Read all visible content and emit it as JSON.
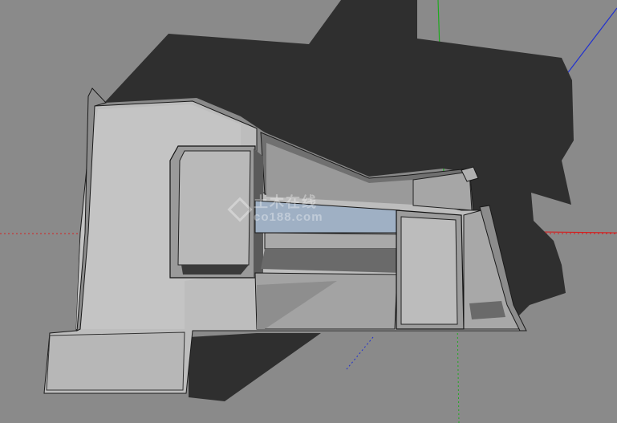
{
  "app": {
    "view": "sketchup-3d-viewport"
  },
  "scene": {
    "description_colors": {
      "background": "#8a8a8a",
      "shadow": "#2f2f2f",
      "floor": "#bdbdbd",
      "wall_dark": "#6f6f6f",
      "edge": "#1a1a1a",
      "axis_red": "#d42020",
      "axis_green": "#1faa1f",
      "axis_blue": "#2030d0",
      "glass": "#9fb0c4"
    }
  },
  "watermark": {
    "cn_text": "土木在线",
    "latin_text": "co188.com"
  }
}
